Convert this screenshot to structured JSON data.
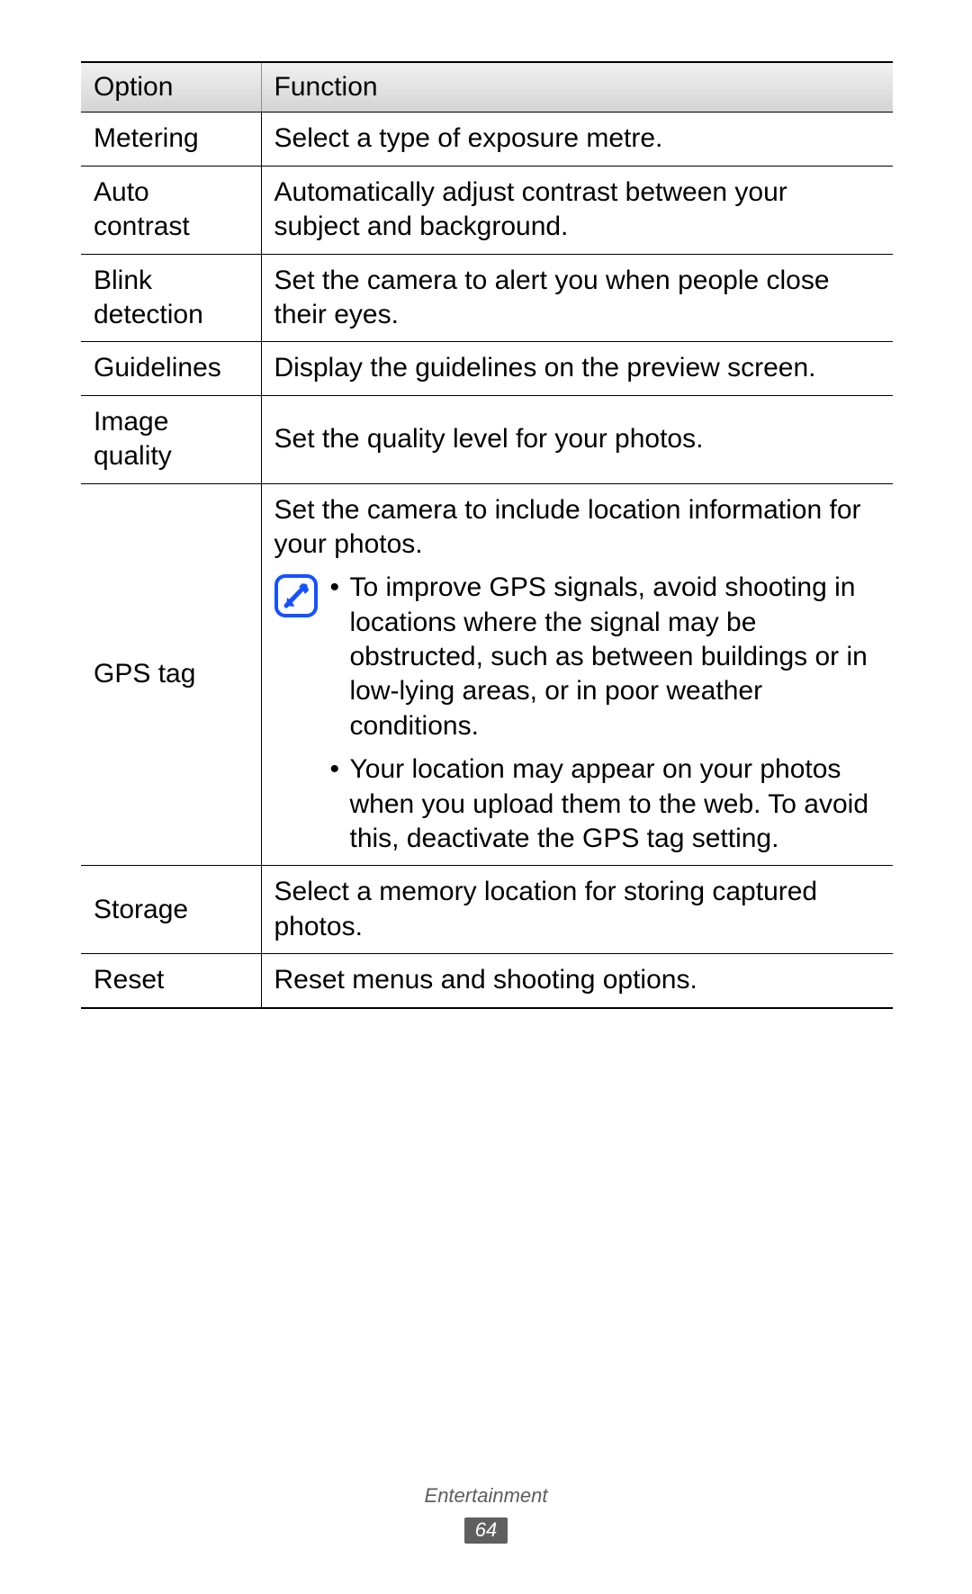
{
  "columns": {
    "option": "Option",
    "function": "Function"
  },
  "rows": {
    "metering": {
      "option": "Metering",
      "function": "Select a type of exposure metre."
    },
    "auto_contrast": {
      "option": "Auto contrast",
      "function": "Automatically adjust contrast between your subject and background."
    },
    "blink_detection": {
      "option": "Blink detection",
      "function": "Set the camera to alert you when people close their eyes."
    },
    "guidelines": {
      "option": "Guidelines",
      "function": "Display the guidelines on the preview screen."
    },
    "image_quality": {
      "option": "Image quality",
      "function": "Set the quality level for your photos."
    },
    "gps_tag": {
      "option": "GPS tag",
      "intro": "Set the camera to include location information for your photos.",
      "notes": {
        "n1": "To improve GPS signals, avoid shooting in locations where the signal may be obstructed, such as between buildings or in low-lying areas, or in poor weather conditions.",
        "n2": "Your location may appear on your photos when you upload them to the web. To avoid this, deactivate the GPS tag setting."
      }
    },
    "storage": {
      "option": "Storage",
      "function": "Select a memory location for storing captured photos."
    },
    "reset": {
      "option": "Reset",
      "function": "Reset menus and shooting options."
    }
  },
  "footer": {
    "section": "Entertainment",
    "page": "64"
  }
}
